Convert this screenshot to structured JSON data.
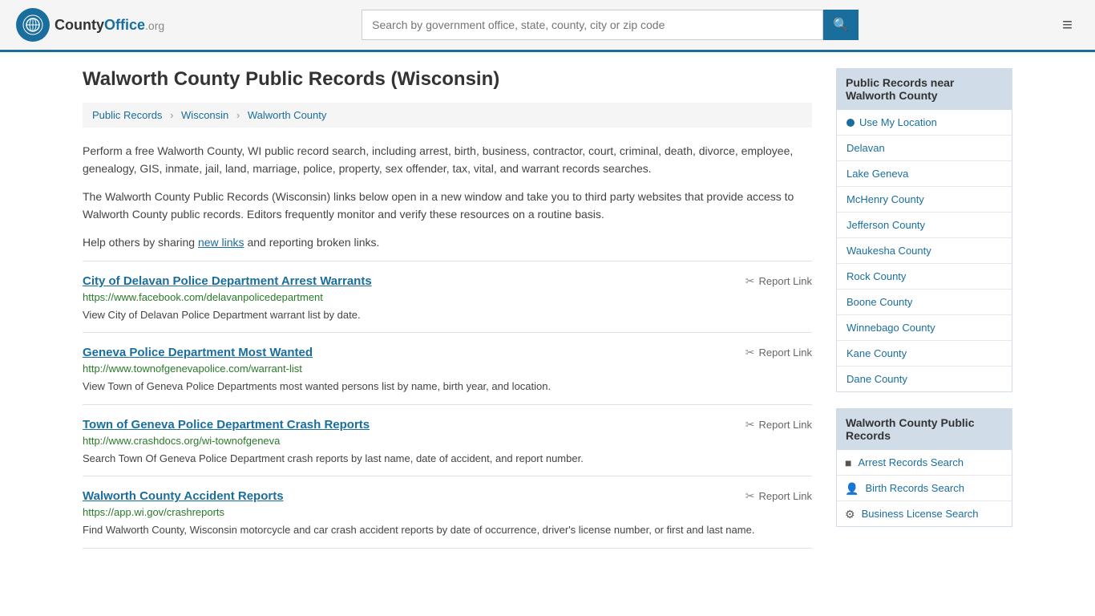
{
  "header": {
    "logo_text": "CountyOffice",
    "logo_tld": ".org",
    "search_placeholder": "Search by government office, state, county, city or zip code",
    "search_icon": "🔍",
    "menu_icon": "≡"
  },
  "page": {
    "title": "Walworth County Public Records (Wisconsin)",
    "breadcrumbs": [
      {
        "label": "Public Records",
        "href": "#"
      },
      {
        "label": "Wisconsin",
        "href": "#"
      },
      {
        "label": "Walworth County",
        "href": "#"
      }
    ],
    "description1": "Perform a free Walworth County, WI public record search, including arrest, birth, business, contractor, court, criminal, death, divorce, employee, genealogy, GIS, inmate, jail, land, marriage, police, property, sex offender, tax, vital, and warrant records searches.",
    "description2": "The Walworth County Public Records (Wisconsin) links below open in a new window and take you to third party websites that provide access to Walworth County public records. Editors frequently monitor and verify these resources on a routine basis.",
    "description3_pre": "Help others by sharing ",
    "description3_link": "new links",
    "description3_post": " and reporting broken links."
  },
  "records": [
    {
      "title": "City of Delavan Police Department Arrest Warrants",
      "url": "https://www.facebook.com/delavanpolicedepartment",
      "description": "View City of Delavan Police Department warrant list by date.",
      "report_label": "Report Link"
    },
    {
      "title": "Geneva Police Department Most Wanted",
      "url": "http://www.townofgenevapolice.com/warrant-list",
      "description": "View Town of Geneva Police Departments most wanted persons list by name, birth year, and location.",
      "report_label": "Report Link"
    },
    {
      "title": "Town of Geneva Police Department Crash Reports",
      "url": "http://www.crashdocs.org/wi-townofgeneva",
      "description": "Search Town Of Geneva Police Department crash reports by last name, date of accident, and report number.",
      "report_label": "Report Link"
    },
    {
      "title": "Walworth County Accident Reports",
      "url": "https://app.wi.gov/crashreports",
      "description": "Find Walworth County, Wisconsin motorcycle and car crash accident reports by date of occurrence, driver's license number, or first and last name.",
      "report_label": "Report Link"
    }
  ],
  "sidebar": {
    "nearby_header": "Public Records near Walworth County",
    "use_location": "Use My Location",
    "nearby_places": [
      {
        "label": "Delavan"
      },
      {
        "label": "Lake Geneva"
      },
      {
        "label": "McHenry County"
      },
      {
        "label": "Jefferson County"
      },
      {
        "label": "Waukesha County"
      },
      {
        "label": "Rock County"
      },
      {
        "label": "Boone County"
      },
      {
        "label": "Winnebago County"
      },
      {
        "label": "Kane County"
      },
      {
        "label": "Dane County"
      }
    ],
    "records_header": "Walworth County Public Records",
    "record_links": [
      {
        "label": "Arrest Records Search",
        "icon_type": "square"
      },
      {
        "label": "Birth Records Search",
        "icon_type": "person"
      },
      {
        "label": "Business License Search",
        "icon_type": "gear"
      }
    ]
  }
}
